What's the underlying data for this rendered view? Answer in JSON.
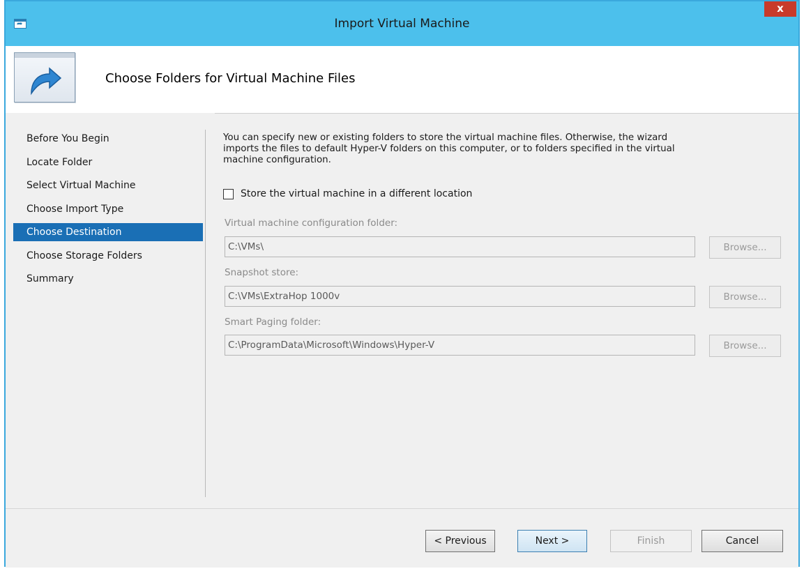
{
  "window": {
    "title": "Import Virtual Machine",
    "close_glyph": "x",
    "app_icon": "import-arrow-icon"
  },
  "header": {
    "title": "Choose Folders for Virtual Machine Files",
    "icon": "import-arrow-icon"
  },
  "nav": {
    "items": [
      {
        "label": "Before You Begin",
        "active": false
      },
      {
        "label": "Locate Folder",
        "active": false
      },
      {
        "label": "Select Virtual Machine",
        "active": false
      },
      {
        "label": "Choose Import Type",
        "active": false
      },
      {
        "label": "Choose Destination",
        "active": true
      },
      {
        "label": "Choose Storage Folders",
        "active": false
      },
      {
        "label": "Summary",
        "active": false
      }
    ]
  },
  "content": {
    "description_lines": [
      "You can specify new or existing folders to store the virtual machine files. Otherwise, the wizard",
      "imports the files to default Hyper-V folders on this computer, or to folders specified in the virtual",
      "machine configuration."
    ],
    "store_checkbox": {
      "label": "Store the virtual machine in a different location",
      "checked": false
    },
    "fields": [
      {
        "label": "Virtual machine configuration folder:",
        "value": "C:\\VMs\\",
        "button": "Browse..."
      },
      {
        "label": "Snapshot store:",
        "value": "C:\\VMs\\ExtraHop 1000v",
        "button": "Browse..."
      },
      {
        "label": "Smart Paging folder:",
        "value": "C:\\ProgramData\\Microsoft\\Windows\\Hyper-V",
        "button": "Browse..."
      }
    ]
  },
  "footer": {
    "previous": "< Previous",
    "next": "Next >",
    "finish": "Finish",
    "cancel": "Cancel"
  },
  "colors": {
    "titlebar": "#4cc0ec",
    "selection": "#1a6fb5",
    "close": "#c83a2a"
  }
}
